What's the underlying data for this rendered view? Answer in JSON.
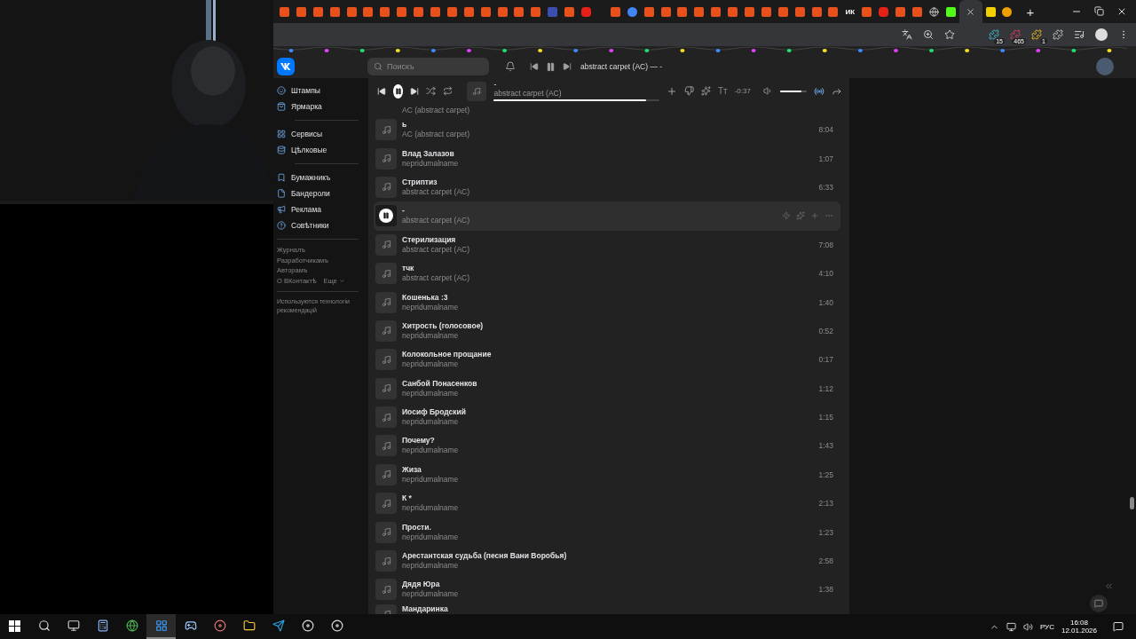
{
  "browser": {
    "tabs": [
      {
        "kind": "ke",
        "selected": false
      },
      {
        "kind": "ke",
        "selected": false
      },
      {
        "kind": "ke",
        "selected": false
      },
      {
        "kind": "ke",
        "selected": false
      },
      {
        "kind": "ke",
        "selected": false
      },
      {
        "kind": "ke",
        "selected": false
      },
      {
        "kind": "ke",
        "selected": false
      },
      {
        "kind": "ke",
        "selected": false
      },
      {
        "kind": "ke",
        "selected": false
      },
      {
        "kind": "ke",
        "selected": false
      },
      {
        "kind": "ke",
        "selected": false
      },
      {
        "kind": "ke",
        "selected": false
      },
      {
        "kind": "ke",
        "selected": false
      },
      {
        "kind": "ke",
        "selected": false
      },
      {
        "kind": "ke",
        "selected": false
      },
      {
        "kind": "ke",
        "selected": false
      },
      {
        "kind": "grid",
        "selected": false
      },
      {
        "kind": "ke",
        "selected": false
      },
      {
        "kind": "video",
        "selected": false
      },
      {
        "kind": "gap"
      },
      {
        "kind": "ke",
        "selected": false
      },
      {
        "kind": "google",
        "selected": false
      },
      {
        "kind": "ke",
        "selected": false
      },
      {
        "kind": "ke",
        "selected": false
      },
      {
        "kind": "ke",
        "selected": false
      },
      {
        "kind": "ke",
        "selected": false
      },
      {
        "kind": "ke",
        "selected": false
      },
      {
        "kind": "ke",
        "selected": false
      },
      {
        "kind": "ke",
        "selected": false
      },
      {
        "kind": "ke",
        "selected": false
      },
      {
        "kind": "ke",
        "selected": false
      },
      {
        "kind": "ke",
        "selected": false
      },
      {
        "kind": "ke",
        "selected": false
      },
      {
        "kind": "ke",
        "selected": false
      },
      {
        "kind": "text",
        "label": "ИК",
        "selected": false
      },
      {
        "kind": "ke",
        "selected": false
      },
      {
        "kind": "video",
        "selected": false
      },
      {
        "kind": "ke",
        "selected": false
      },
      {
        "kind": "ke",
        "selected": false
      },
      {
        "kind": "globe",
        "selected": false
      },
      {
        "kind": "k",
        "selected": false
      },
      {
        "kind": "ke",
        "selected": true
      },
      {
        "kind": "square",
        "selected": false
      },
      {
        "kind": "p",
        "selected": false
      }
    ],
    "new_tab": "+",
    "badges": [
      "15",
      "465",
      "1"
    ]
  },
  "vk": {
    "search": {
      "placeholder": "Поискъ"
    },
    "mini_player": {
      "now_playing": "abstract carpet (AC) — -"
    },
    "nav": [
      [
        {
          "label": "Штампы"
        },
        {
          "label": "Ярмарка"
        }
      ],
      [
        {
          "label": "Сервисы"
        },
        {
          "label": "Цѣлковые"
        }
      ],
      [
        {
          "label": "Бумажникъ"
        },
        {
          "label": "Бандероли"
        },
        {
          "label": "Реклама"
        },
        {
          "label": "Совѣтники"
        }
      ]
    ],
    "footer_links": [
      "Журналъ",
      "Разработчикамъ",
      "Авторамъ",
      "О ВКонтактѣ"
    ],
    "more": "Еще",
    "note": "Используются технологіи рекомендацій",
    "player": {
      "title": "-",
      "artist": "abstract carpet (AC)",
      "level": 0.92,
      "lyrics": "Tт",
      "time": "-0:37",
      "volume": {
        "level": 0.8
      },
      "broadcast": true
    },
    "top_cut_artist": "AC (abstract carpet)",
    "tracks": [
      {
        "title": "ь",
        "artist": "AC (abstract carpet)",
        "duration": "8:04",
        "selected": false
      },
      {
        "title": "Влад Залазов",
        "artist": "nepridumalname",
        "duration": "1:07",
        "selected": false
      },
      {
        "title": "Стриптиз",
        "artist": "abstract carpet (AC)",
        "duration": "6:33",
        "selected": false
      },
      {
        "title": "-",
        "artist": "abstract carpet (AC)",
        "selected": true
      },
      {
        "title": "Стерилизация",
        "artist": "abstract carpet (AC)",
        "duration": "7:08",
        "selected": false
      },
      {
        "title": "тчк",
        "artist": "abstract carpet (AC)",
        "duration": "4:10",
        "selected": false
      },
      {
        "title": "Кошенька :3",
        "artist": "nepridumalname",
        "duration": "1:40",
        "selected": false
      },
      {
        "title": "Хитрость (голосовое)",
        "artist": "nepridumalname",
        "duration": "0:52",
        "selected": false
      },
      {
        "title": "Колокольное прощание",
        "artist": "nepridumalname",
        "duration": "0:17",
        "selected": false
      },
      {
        "title": "Санбой Понасенков",
        "artist": "nepridumalname",
        "duration": "1:12",
        "selected": false
      },
      {
        "title": "Иосиф Бродский",
        "artist": "nepridumalname",
        "duration": "1:15",
        "selected": false
      },
      {
        "title": "Почему?",
        "artist": "nepridumalname",
        "duration": "1:43",
        "selected": false
      },
      {
        "title": "Жиза",
        "artist": "nepridumalname",
        "duration": "1:25",
        "selected": false
      },
      {
        "title": "К *",
        "artist": "nepridumalname",
        "duration": "2:13",
        "selected": false
      },
      {
        "title": "Прости.",
        "artist": "nepridumalname",
        "duration": "1:23",
        "selected": false
      },
      {
        "title": "Арестантская судьба (песня Вани Воробья)",
        "artist": "nepridumalname",
        "duration": "2:58",
        "selected": false
      },
      {
        "title": "Дядя Юра",
        "artist": "nepridumalname",
        "duration": "1:38",
        "selected": false
      }
    ],
    "bottom_cut_title": "Мандаринка"
  },
  "taskbar": {
    "apps": [
      {
        "selected": false
      },
      {
        "selected": false
      },
      {
        "selected": false
      },
      {
        "selected": true
      },
      {
        "selected": false
      },
      {
        "selected": false
      },
      {
        "selected": false
      },
      {
        "selected": false
      },
      {
        "selected": false
      },
      {
        "selected": false
      }
    ],
    "language": "РУС",
    "time": "16:08",
    "date": "12.01.2026"
  }
}
